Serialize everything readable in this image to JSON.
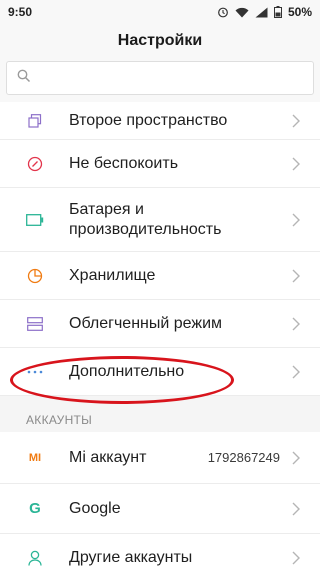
{
  "status": {
    "time": "9:50",
    "battery": "50%"
  },
  "header": {
    "title": "Настройки"
  },
  "search": {
    "placeholder": ""
  },
  "items": [
    {
      "label": "Второе пространство",
      "icon": "dual-space-icon"
    },
    {
      "label": "Не беспокоить",
      "icon": "do-not-disturb-icon"
    },
    {
      "label": "Батарея и\nпроизводительность",
      "line1": "Батарея и",
      "line2": "производительность",
      "icon": "battery-icon"
    },
    {
      "label": "Хранилище",
      "icon": "storage-icon"
    },
    {
      "label": "Облегченный режим",
      "icon": "lite-mode-icon"
    },
    {
      "label": "Дополнительно",
      "icon": "more-icon"
    }
  ],
  "accounts": {
    "section_title": "АККАУНТЫ",
    "items": [
      {
        "label": "Mi аккаунт",
        "value": "1792867249",
        "icon": "mi-icon",
        "icon_text": "MI"
      },
      {
        "label": "Google",
        "icon": "google-icon",
        "icon_text": "G"
      },
      {
        "label": "Другие аккаунты",
        "icon": "user-icon"
      }
    ]
  },
  "colors": {
    "accent_purple": "#8c6fc9",
    "red_icon": "#e2344b",
    "green_icon": "#2bb596",
    "orange_icon": "#f07b12",
    "blue_icon": "#4a89d8",
    "highlight": "#d8141c"
  }
}
